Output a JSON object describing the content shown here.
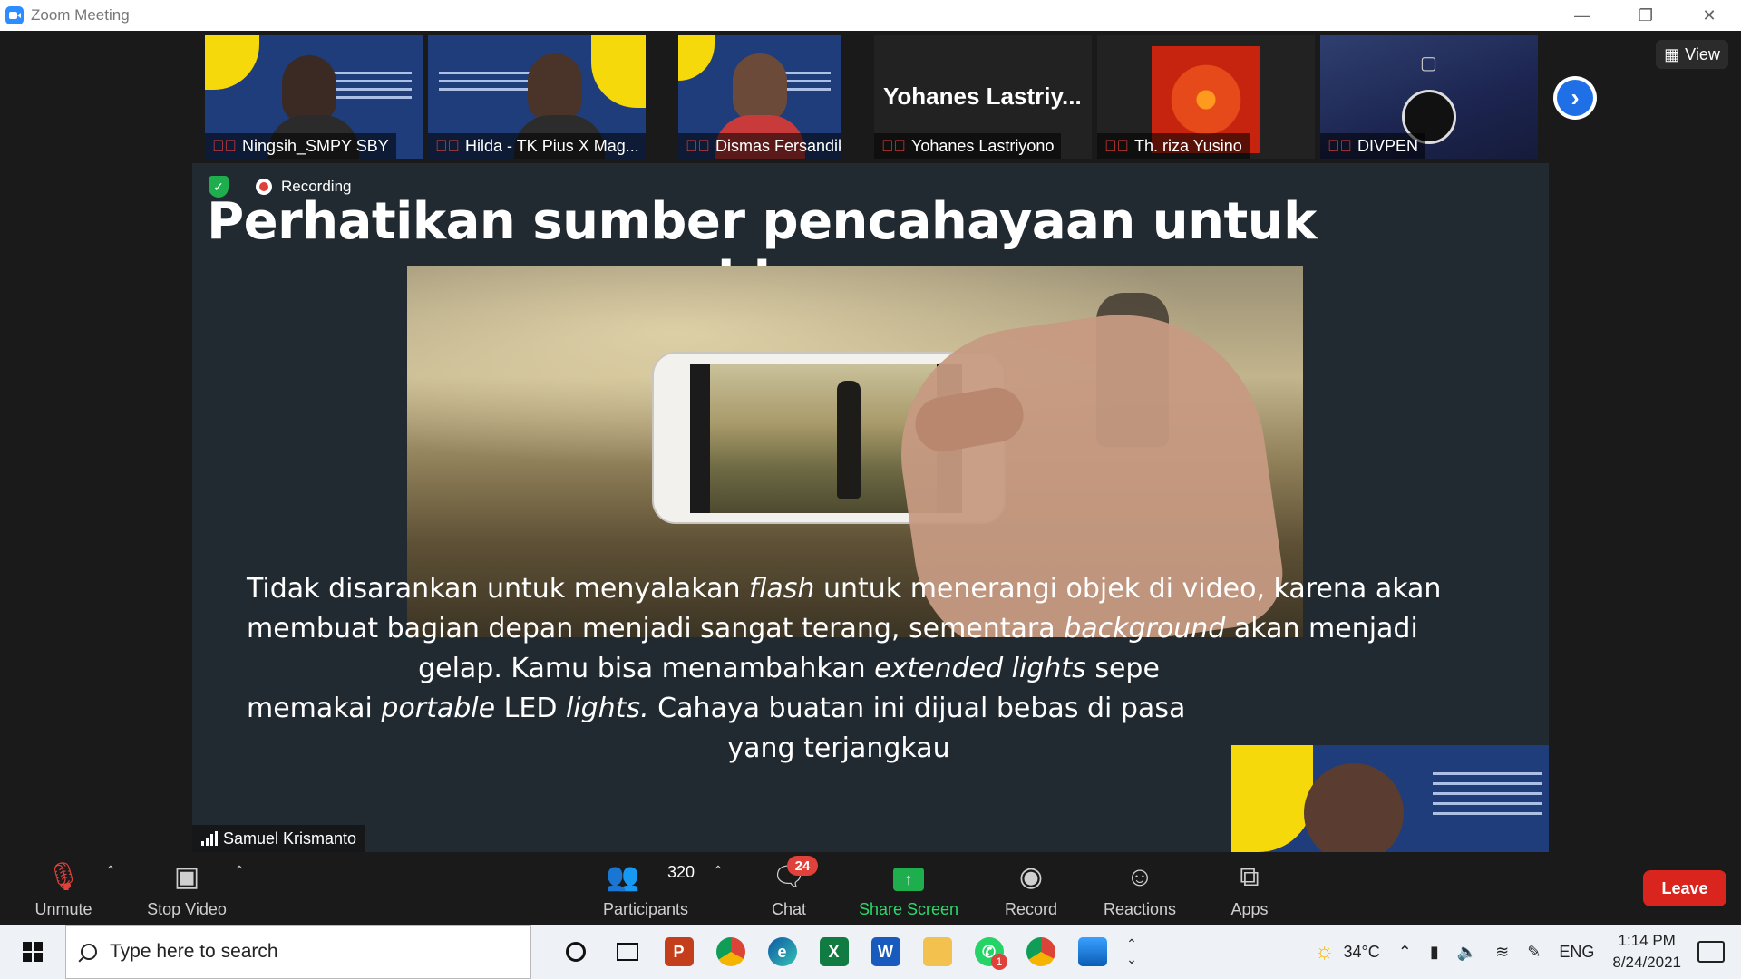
{
  "window": {
    "title": "Zoom Meeting"
  },
  "participants_strip": [
    {
      "name": "Ningsih_SMPY SBY",
      "type": "video-poster"
    },
    {
      "name": "Hilda - TK Pius X Mag...",
      "type": "video-poster"
    },
    {
      "name": "Dismas Fersandika",
      "type": "video-person"
    },
    {
      "name": "Yohanes Lastriyono",
      "display_name": "Yohanes  Lastriy...",
      "type": "name-only"
    },
    {
      "name": "Th. riza Yusino",
      "type": "photo-flower"
    },
    {
      "name": "DIVPEN",
      "type": "obs-logo"
    }
  ],
  "view_button": {
    "label": "View"
  },
  "recording": {
    "label": "Recording"
  },
  "slide": {
    "title": "Perhatikan sumber pencahayaan untuk video",
    "lines": [
      [
        "Tidak disarankan untuk menyalakan ",
        "flash",
        " untuk menerangi objek di video, karena akan"
      ],
      [
        "membuat bagian depan menjadi sangat terang, sementara ",
        "background",
        " akan menjadi"
      ],
      [
        "gelap. Kamu bisa menambahkan ",
        "extended lights",
        " sepe"
      ],
      [
        "memakai ",
        "portable",
        " LED ",
        "lights.",
        " Cahaya buatan ini dijual bebas di pasa"
      ],
      [
        "yang terjangkau"
      ]
    ]
  },
  "active_speaker": {
    "name": "Samuel Krismanto"
  },
  "toolbar": {
    "unmute": "Unmute",
    "stop_video": "Stop Video",
    "participants": "Participants",
    "participants_count": "320",
    "chat": "Chat",
    "chat_badge": "24",
    "share_screen": "Share Screen",
    "record": "Record",
    "reactions": "Reactions",
    "apps": "Apps",
    "leave": "Leave"
  },
  "taskbar": {
    "search_placeholder": "Type here to search",
    "weather": "34°C",
    "language": "ENG",
    "time": "1:14 PM",
    "date": "8/24/2021",
    "whatsapp_badge": "1"
  },
  "colors": {
    "accent": "#2d8cff",
    "leave": "#d9251d",
    "share": "#1eae4e",
    "badge": "#e0413b"
  }
}
